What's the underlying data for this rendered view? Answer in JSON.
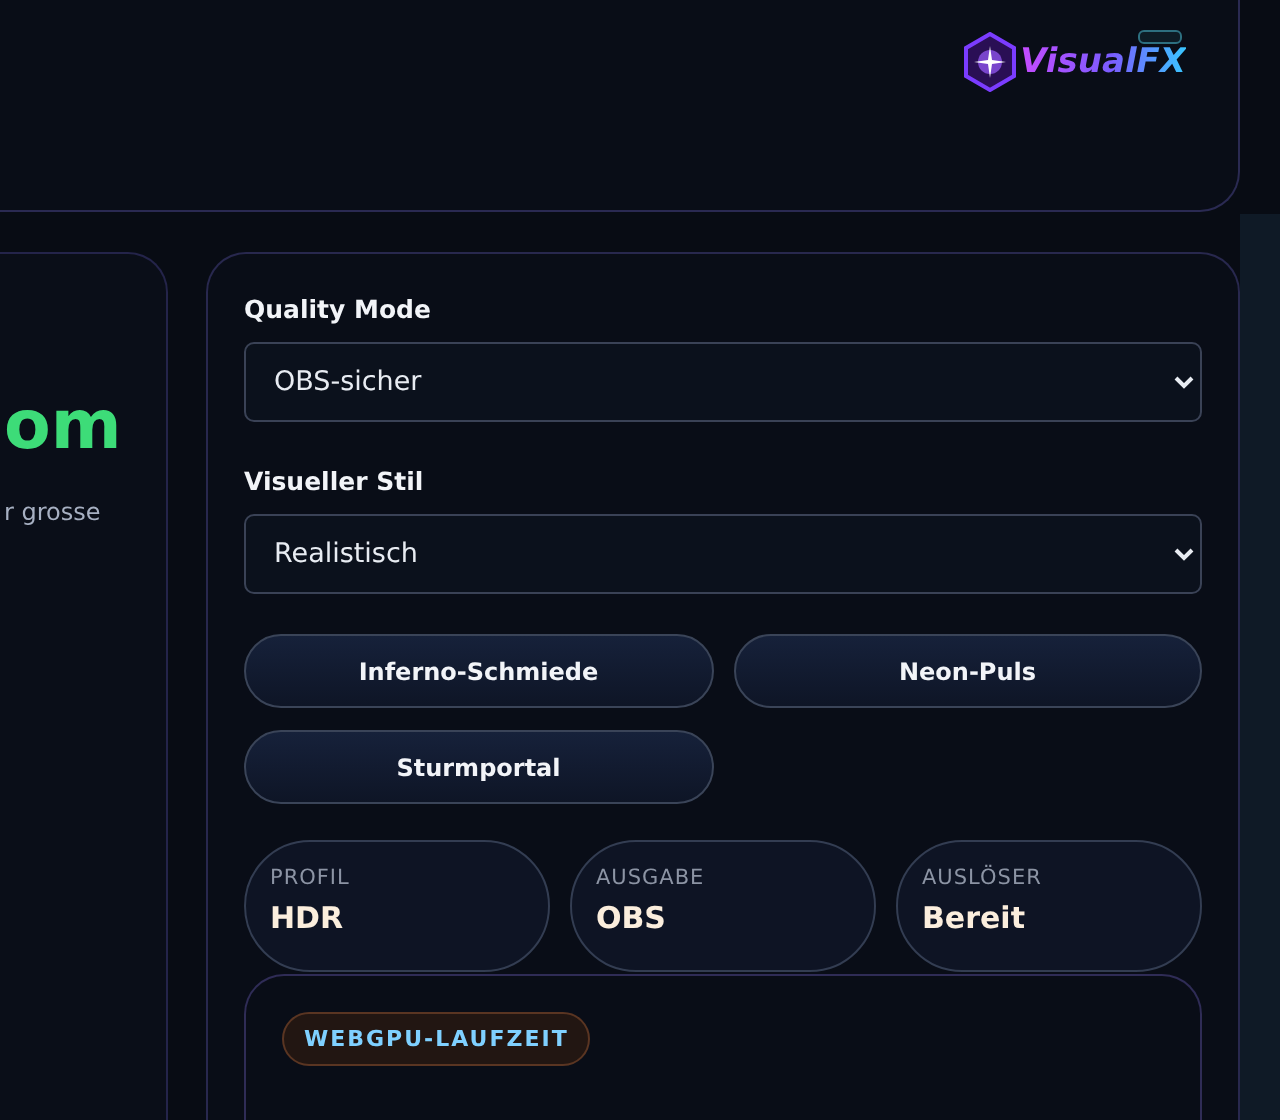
{
  "header": {
    "logo": {
      "text": "VisualFX"
    }
  },
  "hero": {
    "title": "om",
    "subtitle": "r grosse"
  },
  "controls": {
    "fields": [
      {
        "label": "Quality Mode",
        "value": "OBS-sicher"
      },
      {
        "label": "Visueller Stil",
        "value": "Realistisch"
      }
    ],
    "presets": [
      "Inferno-Schmiede",
      "Neon-Puls",
      "Sturmportal"
    ],
    "stats": [
      {
        "label": "PROFIL",
        "value": "HDR"
      },
      {
        "label": "AUSGABE",
        "value": "OBS"
      },
      {
        "label": "AUSLÖSER",
        "value": "Bereit"
      }
    ],
    "runtime": {
      "badge": "WEBGPU-LAUFZEIT"
    }
  }
}
